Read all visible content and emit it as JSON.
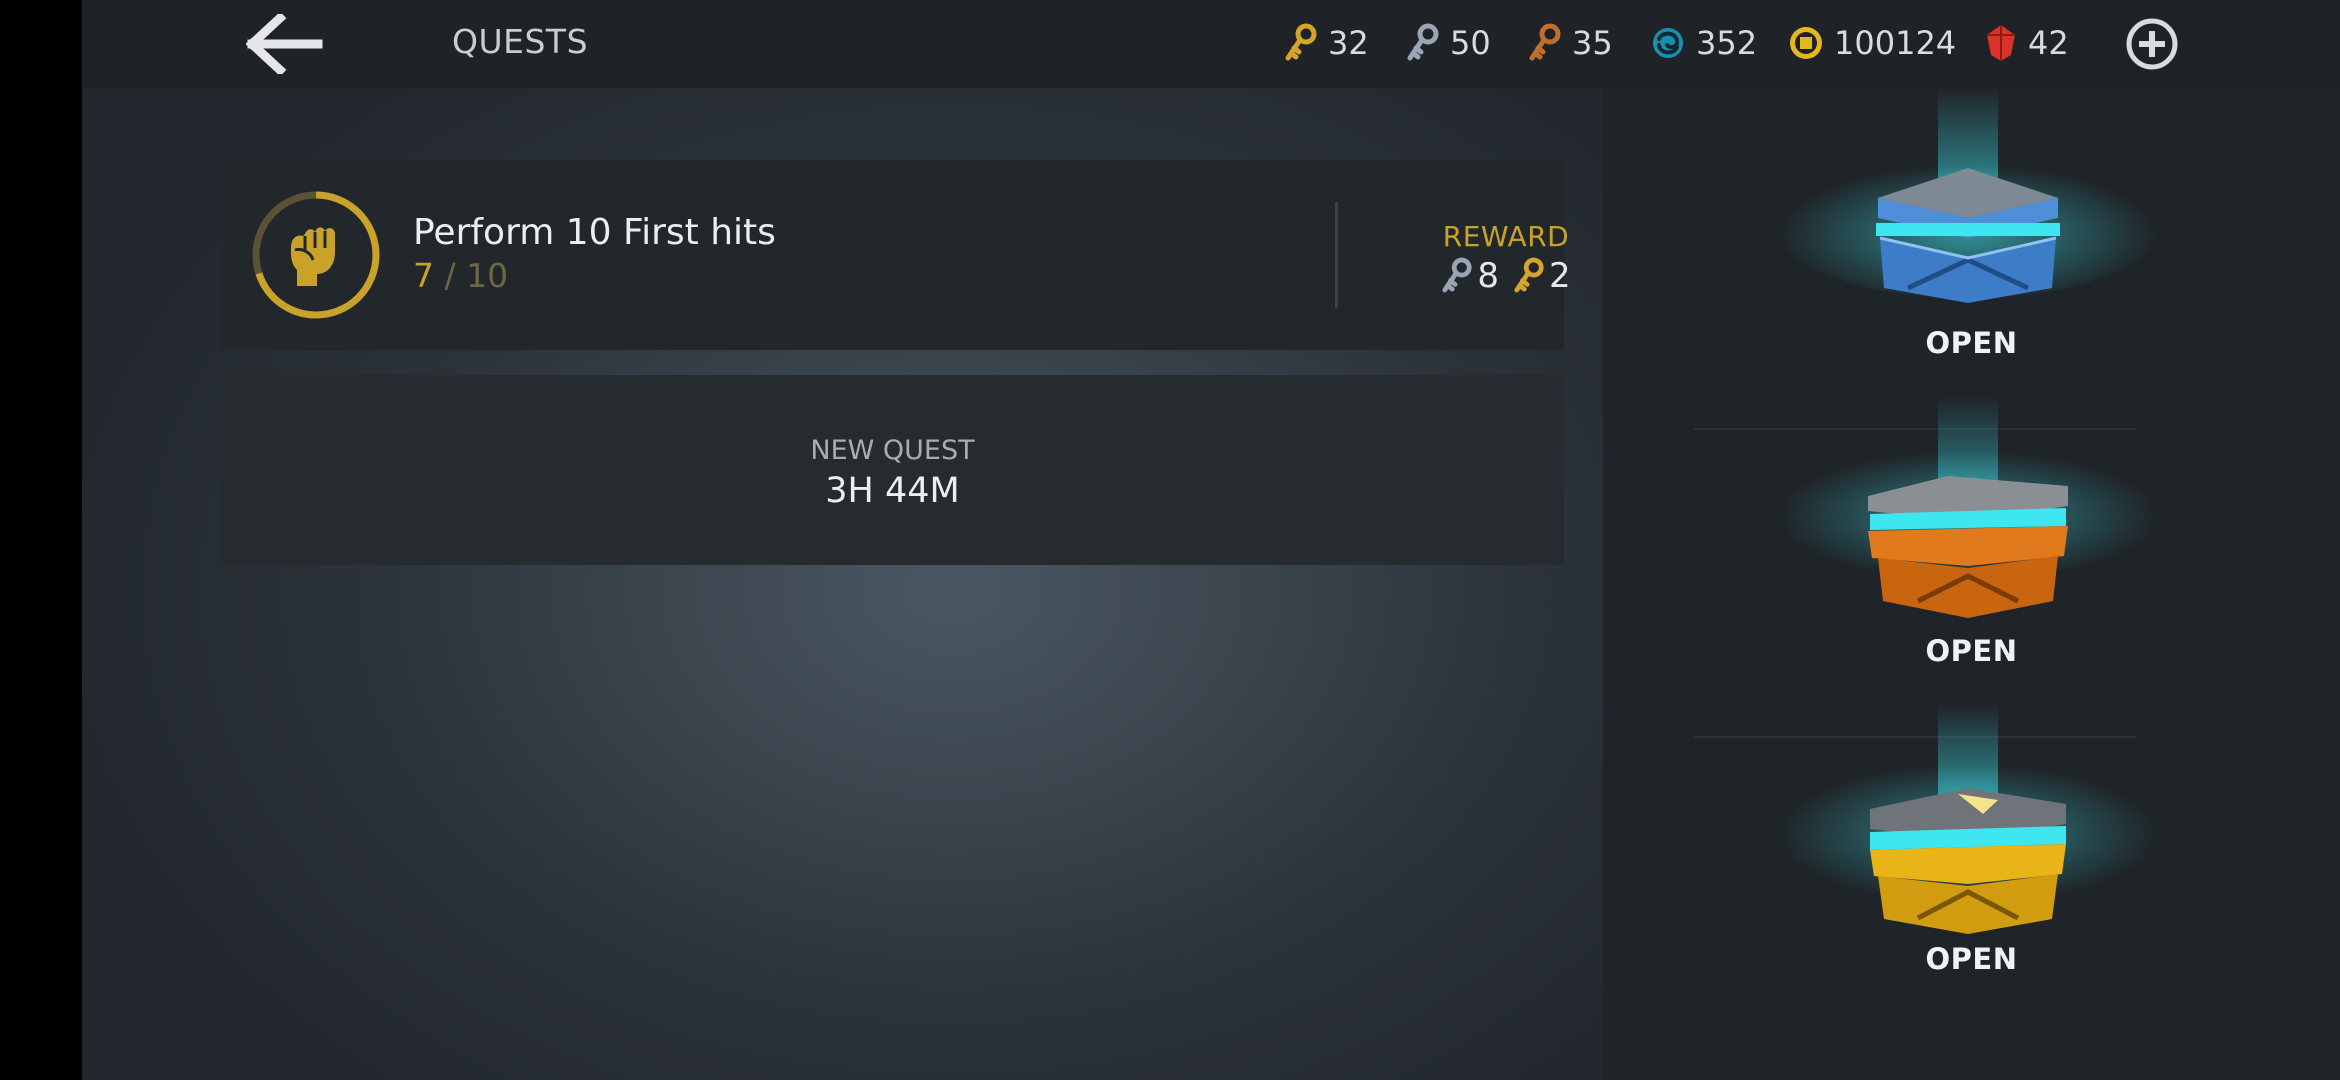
{
  "header": {
    "title": "QUESTS",
    "back_icon": "arrow-left-icon",
    "add_icon": "plus-circle-icon"
  },
  "currencies": [
    {
      "name": "gold-key",
      "value": "32",
      "icon": "gold-key-icon",
      "color": "#d4a52c"
    },
    {
      "name": "silver-key",
      "value": "50",
      "icon": "silver-key-icon",
      "color": "#9aa4b4"
    },
    {
      "name": "bronze-key",
      "value": "35",
      "icon": "bronze-key-icon",
      "color": "#c06e2c"
    },
    {
      "name": "energy",
      "value": "352",
      "icon": "swirl-icon",
      "color": "#23a6c9"
    },
    {
      "name": "coins",
      "value": "100124",
      "icon": "coin-icon",
      "color": "#e2b81c"
    },
    {
      "name": "gems",
      "value": "42",
      "icon": "ruby-icon",
      "color": "#d8322a"
    }
  ],
  "quest": {
    "title": "Perform 10 First hits",
    "progress_current": "7",
    "progress_separator": " / ",
    "progress_total": "10",
    "progress_fraction": 0.7,
    "icon": "fist-icon",
    "reward_label": "REWARD",
    "rewards": [
      {
        "icon": "silver-key-icon",
        "amount": "8"
      },
      {
        "icon": "gold-key-icon",
        "amount": "2"
      }
    ]
  },
  "new_quest": {
    "label": "NEW QUEST",
    "timer": "3H 44M"
  },
  "chests": [
    {
      "icon": "silver-chest-icon",
      "button_label": "OPEN",
      "color": "#4f8fd8"
    },
    {
      "icon": "bronze-chest-icon",
      "button_label": "OPEN",
      "color": "#e07a1c"
    },
    {
      "icon": "gold-chest-icon",
      "button_label": "OPEN",
      "color": "#e8b418"
    }
  ],
  "colors": {
    "accent_gold": "#c9a22a",
    "glow_cyan": "#3ee6f0"
  }
}
